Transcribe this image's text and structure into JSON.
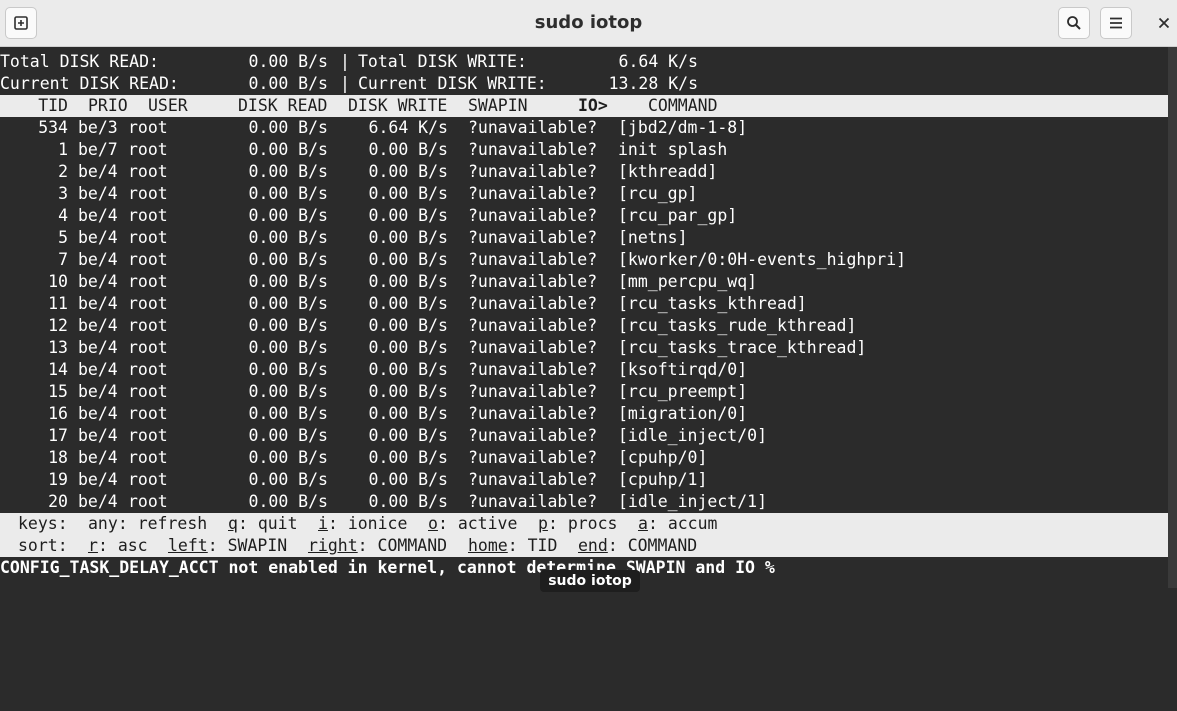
{
  "window": {
    "title": "sudo iotop",
    "icons": [
      "new-tab-icon",
      "search-icon",
      "menu-icon",
      "close-icon"
    ]
  },
  "summary": {
    "total_read_label": "Total DISK READ:",
    "total_read_value": "0.00 B/s",
    "total_write_label": "Total DISK WRITE:",
    "total_write_value": "6.64 K/s",
    "current_read_label": "Current DISK READ:",
    "current_read_value": "0.00 B/s",
    "current_write_label": "Current DISK WRITE:",
    "current_write_value": "13.28 K/s",
    "separator": "|"
  },
  "columns": {
    "tid": "TID",
    "prio": "PRIO",
    "user": "USER",
    "disk_read": "DISK READ",
    "disk_write": "DISK WRITE",
    "swapin": "SWAPIN",
    "io": "IO>",
    "command": "COMMAND"
  },
  "rows": [
    {
      "tid": "534",
      "prio": "be/3",
      "user": "root",
      "read": "0.00 B/s",
      "write": "6.64 K/s",
      "swapin": "?unavailable?",
      "command": "[jbd2/dm-1-8]"
    },
    {
      "tid": "1",
      "prio": "be/7",
      "user": "root",
      "read": "0.00 B/s",
      "write": "0.00 B/s",
      "swapin": "?unavailable?",
      "command": "init splash"
    },
    {
      "tid": "2",
      "prio": "be/4",
      "user": "root",
      "read": "0.00 B/s",
      "write": "0.00 B/s",
      "swapin": "?unavailable?",
      "command": "[kthreadd]"
    },
    {
      "tid": "3",
      "prio": "be/4",
      "user": "root",
      "read": "0.00 B/s",
      "write": "0.00 B/s",
      "swapin": "?unavailable?",
      "command": "[rcu_gp]"
    },
    {
      "tid": "4",
      "prio": "be/4",
      "user": "root",
      "read": "0.00 B/s",
      "write": "0.00 B/s",
      "swapin": "?unavailable?",
      "command": "[rcu_par_gp]"
    },
    {
      "tid": "5",
      "prio": "be/4",
      "user": "root",
      "read": "0.00 B/s",
      "write": "0.00 B/s",
      "swapin": "?unavailable?",
      "command": "[netns]"
    },
    {
      "tid": "7",
      "prio": "be/4",
      "user": "root",
      "read": "0.00 B/s",
      "write": "0.00 B/s",
      "swapin": "?unavailable?",
      "command": "[kworker/0:0H-events_highpri]"
    },
    {
      "tid": "10",
      "prio": "be/4",
      "user": "root",
      "read": "0.00 B/s",
      "write": "0.00 B/s",
      "swapin": "?unavailable?",
      "command": "[mm_percpu_wq]"
    },
    {
      "tid": "11",
      "prio": "be/4",
      "user": "root",
      "read": "0.00 B/s",
      "write": "0.00 B/s",
      "swapin": "?unavailable?",
      "command": "[rcu_tasks_kthread]"
    },
    {
      "tid": "12",
      "prio": "be/4",
      "user": "root",
      "read": "0.00 B/s",
      "write": "0.00 B/s",
      "swapin": "?unavailable?",
      "command": "[rcu_tasks_rude_kthread]"
    },
    {
      "tid": "13",
      "prio": "be/4",
      "user": "root",
      "read": "0.00 B/s",
      "write": "0.00 B/s",
      "swapin": "?unavailable?",
      "command": "[rcu_tasks_trace_kthread]"
    },
    {
      "tid": "14",
      "prio": "be/4",
      "user": "root",
      "read": "0.00 B/s",
      "write": "0.00 B/s",
      "swapin": "?unavailable?",
      "command": "[ksoftirqd/0]"
    },
    {
      "tid": "15",
      "prio": "be/4",
      "user": "root",
      "read": "0.00 B/s",
      "write": "0.00 B/s",
      "swapin": "?unavailable?",
      "command": "[rcu_preempt]"
    },
    {
      "tid": "16",
      "prio": "be/4",
      "user": "root",
      "read": "0.00 B/s",
      "write": "0.00 B/s",
      "swapin": "?unavailable?",
      "command": "[migration/0]"
    },
    {
      "tid": "17",
      "prio": "be/4",
      "user": "root",
      "read": "0.00 B/s",
      "write": "0.00 B/s",
      "swapin": "?unavailable?",
      "command": "[idle_inject/0]"
    },
    {
      "tid": "18",
      "prio": "be/4",
      "user": "root",
      "read": "0.00 B/s",
      "write": "0.00 B/s",
      "swapin": "?unavailable?",
      "command": "[cpuhp/0]"
    },
    {
      "tid": "19",
      "prio": "be/4",
      "user": "root",
      "read": "0.00 B/s",
      "write": "0.00 B/s",
      "swapin": "?unavailable?",
      "command": "[cpuhp/1]"
    },
    {
      "tid": "20",
      "prio": "be/4",
      "user": "root",
      "read": "0.00 B/s",
      "write": "0.00 B/s",
      "swapin": "?unavailable?",
      "command": "[idle_inject/1]"
    }
  ],
  "keys": {
    "label": "keys:",
    "items": [
      {
        "key": "any",
        "sep": ":",
        "desc": "refresh"
      },
      {
        "key": "q",
        "sep": ":",
        "desc": "quit"
      },
      {
        "key": "i",
        "sep": ":",
        "desc": "ionice"
      },
      {
        "key": "o",
        "sep": ":",
        "desc": "active"
      },
      {
        "key": "p",
        "sep": ":",
        "desc": "procs"
      },
      {
        "key": "a",
        "sep": ":",
        "desc": "accum"
      }
    ]
  },
  "sort": {
    "label": "sort:",
    "items": [
      {
        "key": "r",
        "sep": ":",
        "desc": "asc"
      },
      {
        "key": "left",
        "sep": ":",
        "desc": "SWAPIN"
      },
      {
        "key": "right",
        "sep": ":",
        "desc": "COMMAND"
      },
      {
        "key": "home",
        "sep": ":",
        "desc": "TID"
      },
      {
        "key": "end",
        "sep": ":",
        "desc": "COMMAND"
      }
    ]
  },
  "warning": "CONFIG_TASK_DELAY_ACCT not enabled in kernel, cannot determine SWAPIN and IO %",
  "tooltip": "sudo iotop",
  "colors": {
    "terminal_bg": "#2b2b2b",
    "terminal_fg": "#ffffff",
    "header_bg": "#ebebeb",
    "inverse_bg": "#ebebeb",
    "inverse_fg": "#1e1e1e"
  }
}
